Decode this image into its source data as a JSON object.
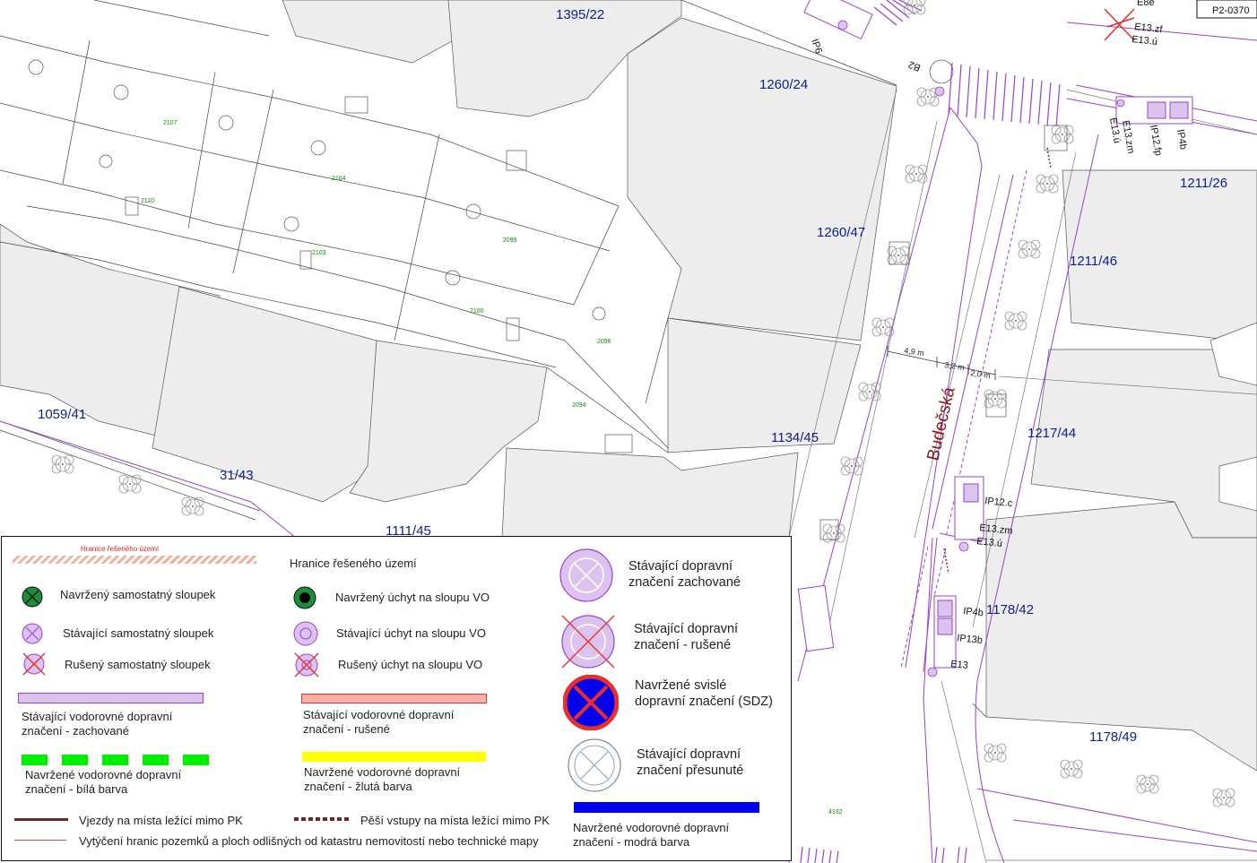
{
  "map": {
    "street_name": "Budečská",
    "parcels": [
      "1395/22",
      "1260/24",
      "1211/26",
      "1260/47",
      "1211/46",
      "1059/41",
      "31/43",
      "1134/45",
      "1217/44",
      "1111/45",
      "1178/42",
      "1178/49"
    ],
    "building_numbers": [
      "2107",
      "2104",
      "2110",
      "2103",
      "2099",
      "2100",
      "2096",
      "2094",
      "4132"
    ],
    "measurements": [
      "4,9 m",
      "3,2 m",
      "2,0 m"
    ],
    "sign_labels": {
      "ip6": "IP6",
      "b2": "B2",
      "e8e": "E8e",
      "p2_ref": "P2-0370",
      "e13zf": "E13.zf",
      "e13u_top": "E13.ú",
      "e13u_v": "E13.ú",
      "e13zm_v": "E13.zm",
      "ip12fp": "IP12.fp",
      "ip4b_v": "IP4b",
      "ip12c": "IP12.c",
      "e13zm": "E13.zm",
      "e13u": "E13.ú",
      "ip4b": "IP4b",
      "ip13b": "IP13b",
      "e13": "E13"
    }
  },
  "legend": {
    "hatch_small_label": "Hranice řešeného území",
    "boundary_label": "Hranice řešeného území",
    "new_post": "Navržený samostatný sloupek",
    "existing_post": "Stávající samostatný sloupek",
    "cancelled_post": "Rušený samostatný sloupek",
    "new_mount": "Navržený úchyt na sloupu VO",
    "existing_mount": "Stávající úchyt na sloupu VO",
    "cancelled_mount": "Rušený úchyt na sloupu VO",
    "kept_signs": [
      "Stávající dopravní",
      "značení zachované"
    ],
    "cancelled_signs": [
      "Stávající dopravní",
      "značení - rušené"
    ],
    "new_vertical": [
      "Navržené svislé",
      "dopravní značení (SDZ)"
    ],
    "moved_signs": [
      "Stávající dopravní",
      "značení přesunuté"
    ],
    "horiz_kept": [
      "Stávající vodorovné dopravní",
      "značení - zachované"
    ],
    "horiz_cancelled": [
      "Stávající vodorovné dopravní",
      "značení - rušené"
    ],
    "horiz_white": [
      "Navržené vodorovné dopravní",
      "značení - bílá barva"
    ],
    "horiz_yellow": [
      "Navržené vodorovné dopravní",
      "značení - žlutá barva"
    ],
    "horiz_blue": [
      "Navržené vodorovné dopravní",
      "značení - modrá barva"
    ],
    "driveways": "Vjezdy na místa ležící mimo PK",
    "ped_entries": "Pěší vstupy na místa ležící mimo PK",
    "boundaries_staking": "Vytýčení hranic pozemků a ploch odlišných od katastru nemovitostí nebo technické mapy"
  },
  "colors": {
    "existing_purple": "#9b3fcf",
    "existing_fill": "#dcc3ee",
    "new_green": "#00ee00",
    "yellow": "#ffff00",
    "blue": "#0000ee",
    "red": "#e8302a",
    "cancelled_fill": "#f6b2a6",
    "driveway": "#6b2a2a",
    "parcel_text": "#0b1f8f",
    "street_text": "#8b1414",
    "building_gray": "#ededed"
  }
}
